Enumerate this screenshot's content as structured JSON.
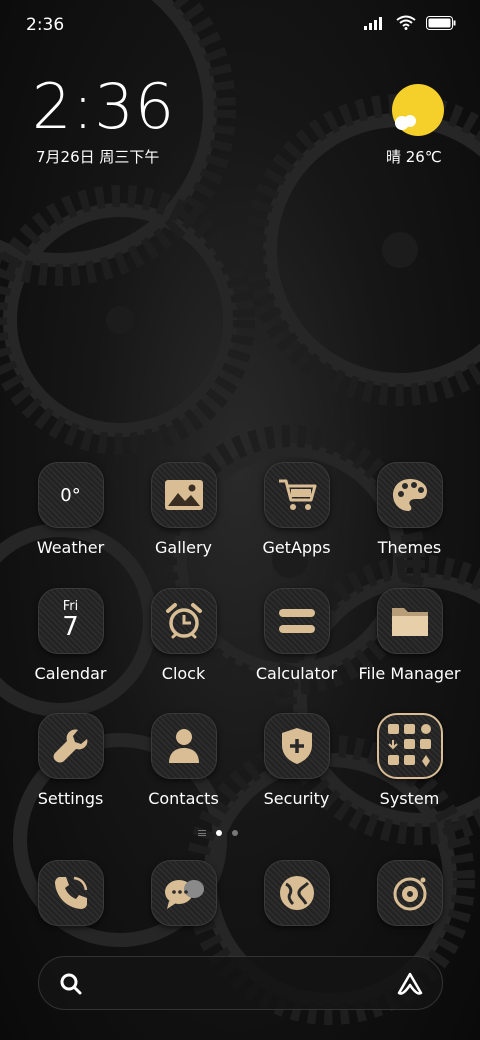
{
  "status_bar": {
    "time": "2:36",
    "icons": [
      "signal-icon",
      "wifi-icon",
      "battery-icon"
    ]
  },
  "clock_widget": {
    "time": "2:36",
    "date": "7月26日 周三下午"
  },
  "weather_widget": {
    "text": "晴 26℃",
    "icon": "sunny-icon",
    "sun_color": "#f5cf2a"
  },
  "apps": [
    {
      "label": "Weather",
      "icon": "weather-icon",
      "icon_text": "0°"
    },
    {
      "label": "Gallery",
      "icon": "gallery-icon"
    },
    {
      "label": "GetApps",
      "icon": "cart-icon"
    },
    {
      "label": "Themes",
      "icon": "palette-icon"
    },
    {
      "label": "Calendar",
      "icon": "calendar-icon",
      "icon_day": "Fri",
      "icon_date": "7"
    },
    {
      "label": "Clock",
      "icon": "alarm-clock-icon"
    },
    {
      "label": "Calculator",
      "icon": "calculator-icon"
    },
    {
      "label": "File Manager",
      "icon": "folder-icon"
    },
    {
      "label": "Settings",
      "icon": "wrench-icon"
    },
    {
      "label": "Contacts",
      "icon": "person-icon"
    },
    {
      "label": "Security",
      "icon": "shield-plus-icon"
    },
    {
      "label": "System",
      "icon": "system-folder-icon"
    }
  ],
  "page_indicator": {
    "pages": 2,
    "active": 0
  },
  "dock": [
    {
      "icon": "phone-icon"
    },
    {
      "icon": "messages-icon"
    },
    {
      "icon": "browser-icon"
    },
    {
      "icon": "camera-icon"
    }
  ],
  "search_bar": {
    "left_icon": "search-icon",
    "right_icon": "assistant-icon"
  },
  "accent_gold": "#d9bd94"
}
